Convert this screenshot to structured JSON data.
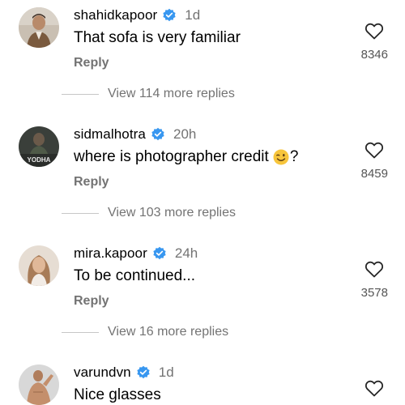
{
  "colors": {
    "verified_badge": "#3897f0",
    "secondary_text": "#737373",
    "primary_text": "#000000"
  },
  "icons": {
    "like": "heart-outline-icon",
    "verified": "verified-badge-icon",
    "emoji": "winking-face-emoji"
  },
  "comments": [
    {
      "username": "shahidkapoor",
      "verified": true,
      "time": "1d",
      "text": "That sofa is very familiar",
      "reply_label": "Reply",
      "likes": "8346",
      "view_replies": "View 114 more replies"
    },
    {
      "username": "sidmalhotra",
      "verified": true,
      "time": "20h",
      "text_before_emoji": "where is photographer credit",
      "text_after_emoji": "?",
      "avatar_text": "YODHA",
      "reply_label": "Reply",
      "likes": "8459",
      "view_replies": "View 103 more replies"
    },
    {
      "username": "mira.kapoor",
      "verified": true,
      "time": "24h",
      "text": "To be continued...",
      "reply_label": "Reply",
      "likes": "3578",
      "view_replies": "View 16 more replies"
    },
    {
      "username": "varundvn",
      "verified": true,
      "time": "1d",
      "text": "Nice glasses"
    }
  ]
}
